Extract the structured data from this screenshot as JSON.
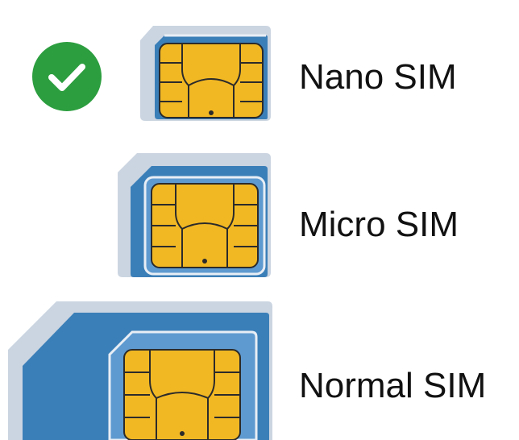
{
  "options": [
    {
      "id": "nano",
      "label": "Nano SIM",
      "selected": true
    },
    {
      "id": "micro",
      "label": "Micro SIM",
      "selected": false
    },
    {
      "id": "normal",
      "label": "Normal SIM",
      "selected": false
    }
  ],
  "colors": {
    "selected_check": "#2c9e3f",
    "sim_body": "#3b7fb8",
    "sim_body_light": "#5e9ad0",
    "sim_shadow": "#cbd5e1",
    "chip_gold": "#f2b824",
    "chip_outline": "#2b2b2b",
    "label_text": "#111111"
  },
  "icons": {
    "selected": "check-circle-icon",
    "sim": "sim-card-icon",
    "chip": "sim-chip-icon"
  }
}
